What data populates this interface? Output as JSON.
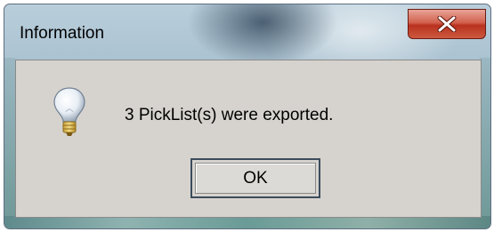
{
  "dialog": {
    "title": "Information",
    "message": "3 PickList(s) were exported.",
    "ok_label": "OK",
    "icon": "lightbulb-icon",
    "close_icon": "close-icon"
  },
  "colors": {
    "client_background": "#d6d3ce",
    "close_button": "#c94a35"
  }
}
